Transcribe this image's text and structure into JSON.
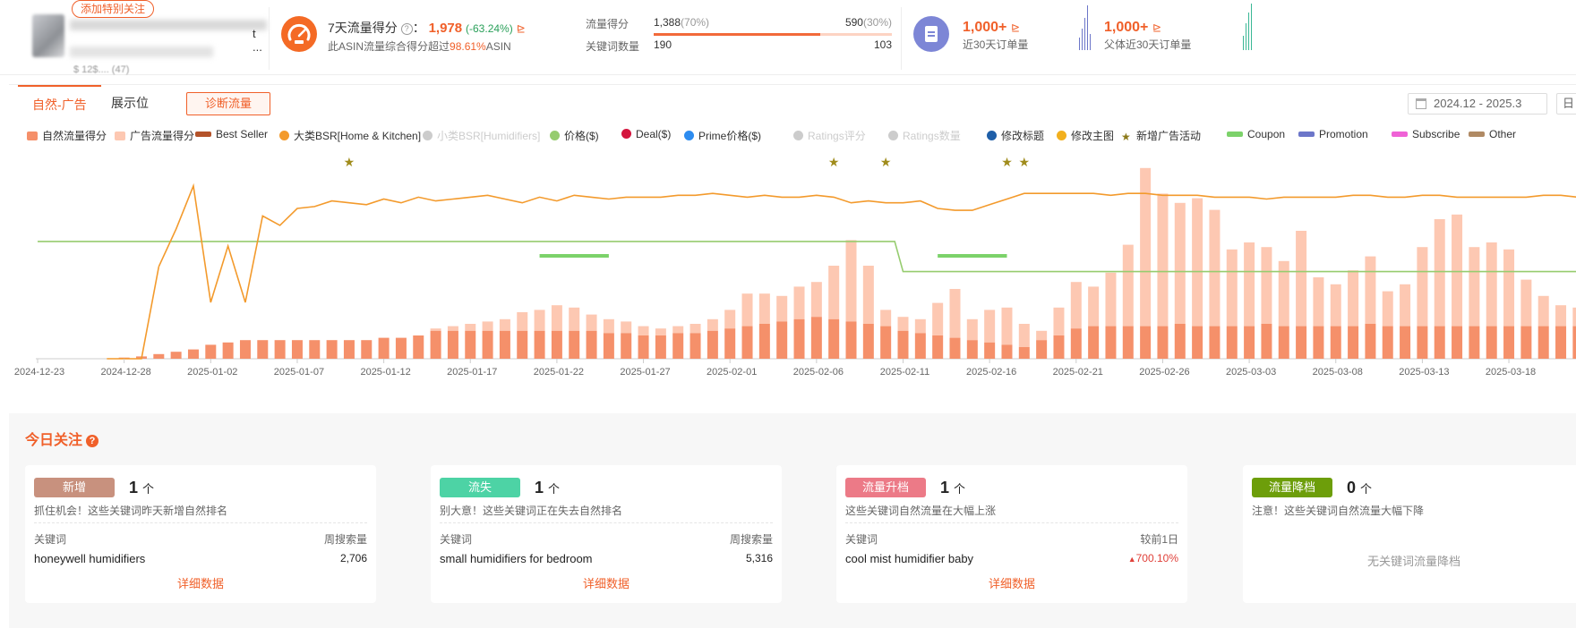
{
  "product": {
    "follow_tag": "添加特别关注",
    "title_suffix": "t ...",
    "price_text": "$ 12$.... (47)"
  },
  "traffic_score": {
    "title": "7天流量得分",
    "value": "1,978",
    "change": "(-63.24%)",
    "note_prefix": "此ASIN流量综合得分超过",
    "note_pct": "98.61%",
    "note_suffix": "ASIN"
  },
  "flow": {
    "label_score": "流量得分",
    "label_keywords": "关键词数量",
    "organic_score": "1,388",
    "organic_pct": "(70%)",
    "ad_score": "590",
    "ad_pct": "(30%)",
    "organic_fraction": 0.7,
    "kw_organic": "190",
    "kw_ad": "103"
  },
  "orders": [
    {
      "value": "1,000+",
      "label": "近30天订单量"
    },
    {
      "value": "1,000+",
      "label": "父体近30天订单量"
    }
  ],
  "tabs": [
    {
      "label": "自然-广告"
    },
    {
      "label": "展示位"
    }
  ],
  "diagnose_button": "诊断流量",
  "date_range": "2024.12 - 2025.3",
  "day_button": "日",
  "legend": [
    {
      "label": "自然流量得分",
      "color": "#f5906a",
      "shape": "sq",
      "on": true
    },
    {
      "label": "广告流量得分",
      "color": "#fdc8b2",
      "shape": "sq",
      "on": true
    },
    {
      "label": "Best Seller",
      "color": "#b4532a",
      "shape": "bar",
      "on": true
    },
    {
      "label": "大类BSR[Home & Kitchen]",
      "color": "#f39a2c",
      "shape": "circ",
      "on": true
    },
    {
      "label": "小类BSR[Humidifiers]",
      "color": "#ccc",
      "shape": "circ",
      "on": false
    },
    {
      "label": "价格($)",
      "color": "#96cc6f",
      "shape": "circ",
      "on": true
    },
    {
      "label": "Deal($)",
      "color": "#d4153e",
      "shape": "circ",
      "on": true
    },
    {
      "label": "Prime价格($)",
      "color": "#2d8cf0",
      "shape": "circ",
      "on": true
    },
    {
      "label": "Ratings评分",
      "color": "#ccc",
      "shape": "circ",
      "on": false
    },
    {
      "label": "Ratings数量",
      "color": "#ccc",
      "shape": "circ",
      "on": false
    },
    {
      "label": "修改标题",
      "color": "#1f5fa8",
      "shape": "circ",
      "on": true
    },
    {
      "label": "修改主图",
      "color": "#f2b01e",
      "shape": "circ",
      "on": true
    },
    {
      "label": "新增广告活动",
      "color": "#8c7a1a",
      "shape": "star",
      "on": true
    },
    {
      "label": "Coupon",
      "color": "#7cd26a",
      "shape": "bar",
      "on": true
    },
    {
      "label": "Promotion",
      "color": "#6c76c9",
      "shape": "bar",
      "on": true
    },
    {
      "label": "Subscribe",
      "color": "#ef62d6",
      "shape": "bar",
      "on": true
    },
    {
      "label": "Other",
      "color": "#b08a64",
      "shape": "bar",
      "on": true
    }
  ],
  "chart_data": {
    "type": "bar",
    "x_tick_labels": [
      "2024-12-23",
      "2024-12-28",
      "2025-01-02",
      "2025-01-07",
      "2025-01-12",
      "2025-01-17",
      "2025-01-22",
      "2025-01-27",
      "2025-02-01",
      "2025-02-06",
      "2025-02-11",
      "2025-02-16",
      "2025-02-21",
      "2025-02-26",
      "2025-03-03",
      "2025-03-08",
      "2025-03-13",
      "2025-03-18"
    ],
    "start_date": "2024-12-23",
    "series": [
      {
        "name": "自然流量得分",
        "values": [
          0,
          0,
          0,
          0,
          0,
          0.5,
          1,
          2,
          3,
          4,
          6,
          7,
          8,
          8,
          8,
          8,
          8,
          8,
          8,
          8,
          9,
          9,
          10,
          12,
          12,
          12,
          12,
          12,
          12,
          12,
          12,
          12,
          12,
          11,
          11,
          10,
          10,
          11,
          11,
          12,
          13,
          14,
          15,
          16,
          17,
          18,
          17,
          16,
          15,
          14,
          12,
          11,
          10,
          9,
          8,
          7,
          6,
          5,
          8,
          10,
          13,
          14,
          14,
          14,
          14,
          14,
          15,
          14,
          14,
          14,
          14,
          15,
          14,
          14,
          14,
          14,
          14,
          15,
          14,
          14,
          14,
          14,
          14,
          14,
          14,
          14,
          14,
          14,
          14,
          14,
          14,
          14,
          13,
          12,
          12,
          12
        ]
      },
      {
        "name": "广告流量得分",
        "values": [
          0,
          0,
          0,
          0,
          0,
          0,
          0,
          0,
          0,
          0,
          0,
          0,
          0,
          0,
          0,
          0,
          0,
          0,
          0,
          0,
          0,
          0,
          0,
          1,
          2,
          3,
          4,
          5,
          8,
          9,
          11,
          10,
          7,
          6,
          5,
          4,
          3,
          3,
          4,
          5,
          8,
          14,
          13,
          11,
          14,
          15,
          23,
          35,
          25,
          7,
          6,
          6,
          14,
          21,
          9,
          14,
          16,
          10,
          4,
          12,
          20,
          17,
          23,
          35,
          68,
          57,
          52,
          55,
          50,
          33,
          36,
          33,
          28,
          41,
          21,
          18,
          24,
          29,
          15,
          18,
          34,
          46,
          48,
          34,
          36,
          33,
          20,
          13,
          9,
          8,
          7,
          8,
          10
        ]
      },
      {
        "name": "大类BSR[Home & Kitchen]",
        "values": [
          null,
          null,
          null,
          null,
          null,
          null,
          null,
          49,
          69,
          92,
          30,
          60,
          30,
          76,
          71,
          80,
          81,
          84,
          83,
          82,
          85,
          83,
          86,
          84,
          85,
          86,
          87,
          85,
          83,
          86,
          84,
          87,
          86,
          85,
          86,
          86,
          86,
          87,
          87,
          88,
          87,
          86,
          87,
          86,
          86,
          87,
          86,
          83,
          84,
          83,
          83,
          84,
          80,
          79,
          79,
          82,
          85,
          88,
          88,
          88,
          88,
          88,
          87,
          88,
          88,
          87,
          87,
          87,
          86,
          86,
          86,
          85,
          86,
          86,
          86,
          86,
          87,
          87,
          86,
          86,
          87,
          87,
          86,
          86,
          86,
          86,
          86,
          87,
          87,
          86,
          86,
          87,
          87
        ]
      },
      {
        "name": "价格($)",
        "values_note": "step",
        "before": 78,
        "after": 58
      }
    ],
    "events": {
      "新增广告活动": [
        "2025-01-10",
        "2025-02-07",
        "2025-02-10",
        "2025-02-17",
        "2025-02-18"
      ],
      "Coupon": [
        [
          "2025-01-21",
          "2025-01-25"
        ],
        [
          "2025-02-13",
          "2025-02-17"
        ]
      ]
    }
  },
  "today": {
    "title": "今日关注",
    "cards": [
      {
        "badge": "新增",
        "color": "#c8917e",
        "count": "1",
        "unit": "个",
        "desc": "抓住机会！这些关键词昨天新增自然排名",
        "col_l": "关键词",
        "col_r": "周搜索量",
        "keyword": "honeywell humidifiers",
        "value": "2,706",
        "up": false,
        "link": "详细数据"
      },
      {
        "badge": "流失",
        "color": "#4dd3a5",
        "count": "1",
        "unit": "个",
        "desc": "别大意！这些关键词正在失去自然排名",
        "col_l": "关键词",
        "col_r": "周搜索量",
        "keyword": "small humidifiers for bedroom",
        "value": "5,316",
        "up": false,
        "link": "详细数据"
      },
      {
        "badge": "流量升档",
        "color": "#ec7a87",
        "count": "1",
        "unit": "个",
        "desc": "这些关键词自然流量在大幅上涨",
        "col_l": "关键词",
        "col_r": "较前1日",
        "keyword": "cool mist humidifier baby",
        "value": "700.10%",
        "up": true,
        "link": "详细数据"
      },
      {
        "badge": "流量降档",
        "color": "#6d9e0a",
        "count": "0",
        "unit": "个",
        "desc": "注意！这些关键词自然流量大幅下降",
        "empty": "无关键词流量降档"
      }
    ]
  }
}
